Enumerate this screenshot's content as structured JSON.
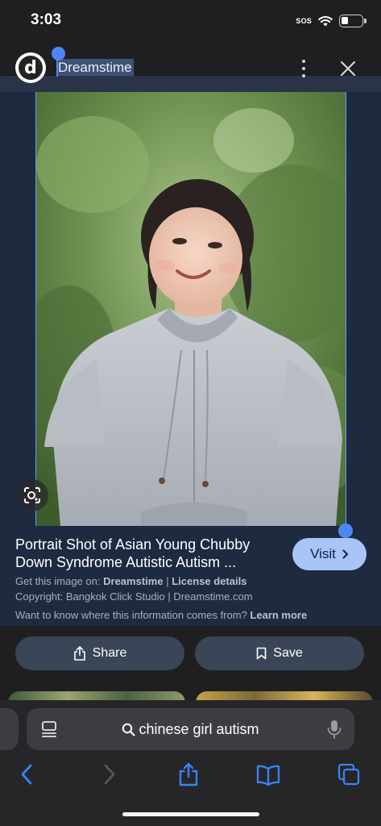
{
  "status": {
    "time": "3:03",
    "sos": "SOS"
  },
  "header": {
    "logo_letter": "d",
    "site_name": "Dreamstime"
  },
  "image_info": {
    "title": "Portrait Shot of Asian Young Chubby Down Syndrome Autistic Autism ...",
    "visit_label": "Visit",
    "get_image_prefix": "Get this image on:",
    "get_image_source": "Dreamstime",
    "license_label": "License details",
    "copyright": "Copyright: Bangkok Click Studio | Dreamstime.com",
    "info_question": "Want to know where this information comes from?",
    "learn_more": "Learn more"
  },
  "actions": {
    "share_label": "Share",
    "save_label": "Save"
  },
  "browser": {
    "url_text": "chinese girl autism"
  },
  "colors": {
    "accent": "#4f86f7",
    "visit_button": "#a9c4f7",
    "toolbar_icon": "#3a82f7"
  }
}
